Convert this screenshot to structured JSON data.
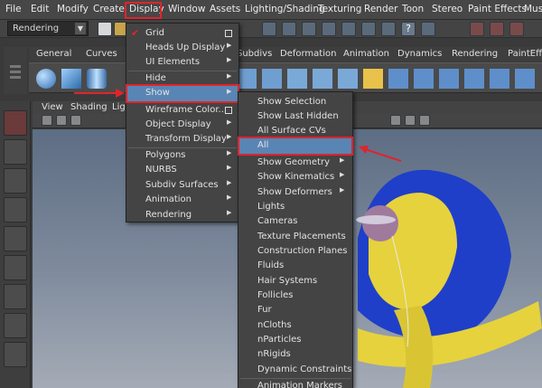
{
  "menubar": {
    "items": [
      "File",
      "Edit",
      "Modify",
      "Create",
      "Display",
      "Window",
      "Assets",
      "Lighting/Shading",
      "Texturing",
      "Render",
      "Toon",
      "Stereo",
      "Paint Effects",
      "Muscle"
    ]
  },
  "statusline": {
    "mode": "Rendering"
  },
  "shelf": {
    "tabs": [
      "General",
      "Curves",
      "Subdivs",
      "Deformation",
      "Animation",
      "Dynamics",
      "Rendering",
      "PaintEffe"
    ]
  },
  "viewport": {
    "menu": [
      "View",
      "Shading",
      "Lighting"
    ]
  },
  "display_menu": {
    "items": [
      {
        "label": "Grid",
        "checked": true,
        "option_box": true
      },
      {
        "label": "Heads Up Display",
        "submenu": true
      },
      {
        "label": "UI Elements",
        "submenu": true
      },
      {
        "label": "Hide",
        "submenu": true
      },
      {
        "label": "Show",
        "submenu": true,
        "highlighted": true
      },
      {
        "label": "Wireframe Color...",
        "option_box": true
      },
      {
        "label": "Object Display",
        "submenu": true
      },
      {
        "label": "Transform Display",
        "submenu": true
      },
      {
        "label": "Polygons",
        "submenu": true
      },
      {
        "label": "NURBS",
        "submenu": true
      },
      {
        "label": "Subdiv Surfaces",
        "submenu": true
      },
      {
        "label": "Animation",
        "submenu": true
      },
      {
        "label": "Rendering",
        "submenu": true
      }
    ]
  },
  "show_menu": {
    "items": [
      {
        "label": "Show Selection"
      },
      {
        "label": "Show Last Hidden"
      },
      {
        "label": "All Surface CVs"
      },
      {
        "label": "All",
        "highlighted": true
      },
      {
        "label": "Show Geometry",
        "submenu": true
      },
      {
        "label": "Show Kinematics",
        "submenu": true
      },
      {
        "label": "Show Deformers",
        "submenu": true
      },
      {
        "label": "Lights"
      },
      {
        "label": "Cameras"
      },
      {
        "label": "Texture Placements"
      },
      {
        "label": "Construction Planes"
      },
      {
        "label": "Fluids"
      },
      {
        "label": "Hair Systems"
      },
      {
        "label": "Follicles"
      },
      {
        "label": "Fur"
      },
      {
        "label": "nCloths"
      },
      {
        "label": "nParticles"
      },
      {
        "label": "nRigids"
      },
      {
        "label": "Dynamic Constraints"
      },
      {
        "label": "Animation Markers"
      }
    ]
  },
  "colors": {
    "highlight": "#5985b4",
    "annotation_red": "#e0242c",
    "menu_bg": "#444444"
  }
}
